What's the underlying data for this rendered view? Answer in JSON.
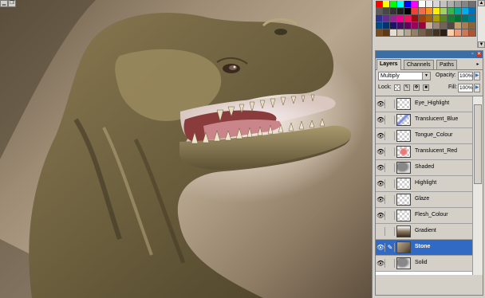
{
  "panel": {
    "tabs": [
      {
        "label": "Layers",
        "active": true
      },
      {
        "label": "Channels",
        "active": false
      },
      {
        "label": "Paths",
        "active": false
      }
    ],
    "blend_mode": "Multiply",
    "opacity_label": "Opacity:",
    "opacity_value": "100%",
    "lock_label": "Lock:",
    "fill_label": "Fill:",
    "fill_value": "100%",
    "layers": [
      {
        "name": "Eye_Highlight",
        "visible": true,
        "selected": false,
        "thumb": "transparent"
      },
      {
        "name": "Translucent_Blue",
        "visible": true,
        "selected": false,
        "thumb": "blue-strokes"
      },
      {
        "name": "Tongue_Colour",
        "visible": true,
        "selected": false,
        "thumb": "transparent"
      },
      {
        "name": "Translucent_Red",
        "visible": true,
        "selected": false,
        "thumb": "red-strokes"
      },
      {
        "name": "Shaded",
        "visible": true,
        "selected": false,
        "thumb": "dino-grey"
      },
      {
        "name": "Highlight",
        "visible": true,
        "selected": false,
        "thumb": "transparent"
      },
      {
        "name": "Glaze",
        "visible": true,
        "selected": false,
        "thumb": "transparent"
      },
      {
        "name": "Flesh_Colour",
        "visible": true,
        "selected": false,
        "thumb": "transparent"
      },
      {
        "name": "Gradient",
        "visible": false,
        "selected": false,
        "thumb": "gradient"
      },
      {
        "name": "Stone",
        "visible": true,
        "selected": true,
        "thumb": "stone"
      },
      {
        "name": "Solid",
        "visible": true,
        "selected": false,
        "thumb": "dino-grey"
      }
    ]
  },
  "colors": {
    "selection": "#316ac5",
    "panel_bg": "#d4d0c8",
    "palette_bar": "#3a6ea5"
  },
  "swatches": [
    "#ff0000",
    "#ffff00",
    "#00ff00",
    "#00ffff",
    "#0000ff",
    "#ff00ff",
    "#ffffff",
    "#ebebeb",
    "#d6d6d6",
    "#c2c2c2",
    "#adadad",
    "#999999",
    "#858585",
    "#707070",
    "#5c5c5c",
    "#474747",
    "#333333",
    "#1f1f1f",
    "#000000",
    "#ef4136",
    "#f26d4a",
    "#f7941d",
    "#fff200",
    "#a3d165",
    "#39b54a",
    "#00a99d",
    "#00aeef",
    "#0072bc",
    "#2e3192",
    "#662d91",
    "#92278f",
    "#ec008c",
    "#ed145b",
    "#9e0b0f",
    "#a0410d",
    "#a36209",
    "#aba000",
    "#598527",
    "#197b30",
    "#007236",
    "#00746b",
    "#0076a3",
    "#004a80",
    "#003471",
    "#1b1464",
    "#440e62",
    "#630460",
    "#9e005d",
    "#9e0039",
    "#c7b299",
    "#998675",
    "#736357",
    "#534741",
    "#c69c6d",
    "#a67c52",
    "#8c6239",
    "#754c24",
    "#603913",
    "#e6ddd1",
    "#cfc3b2",
    "#b5a48f",
    "#948066",
    "#776249",
    "#5d4a33",
    "#42321f",
    "#2a1f12",
    "#ffccaa",
    "#ee9977",
    "#cc7755",
    "#aa5533"
  ]
}
